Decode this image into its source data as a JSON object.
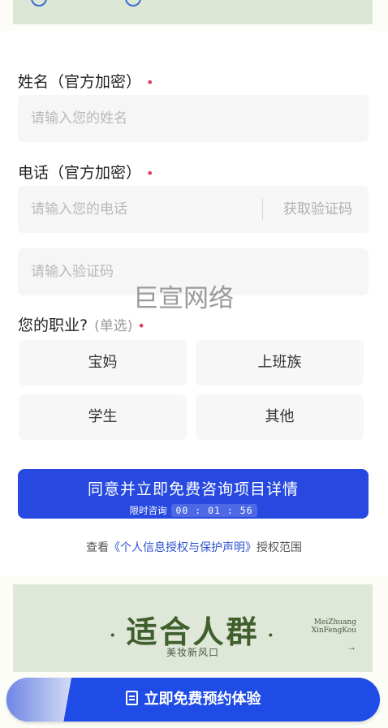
{
  "form": {
    "name_label": "姓名（官方加密）",
    "name_placeholder": "请输入您的姓名",
    "phone_label": "电话（官方加密）",
    "phone_placeholder": "请输入您的电话",
    "get_code": "获取验证码",
    "code_placeholder": "请输入验证码",
    "required_mark": "•",
    "job_label": "您的职业?",
    "job_hint": "(单选)",
    "options": [
      "宝妈",
      "上班族",
      "学生",
      "其他"
    ],
    "submit_main": "同意并立即免费咨询项目详情",
    "submit_sub": "限时咨询",
    "timer": "00 : 01 : 56",
    "agree_prefix": "查看",
    "agree_link": "《个人信息授权与保护声明》",
    "agree_suffix": "授权范围"
  },
  "watermark": "巨宣网络",
  "crowd": {
    "title": "适合人群",
    "subtitle": "美妆新风口",
    "tag_line1": "MeiZhuang",
    "tag_line2": "XinFengKou",
    "arrow": "→"
  },
  "cta": {
    "label": "立即免费预约体验"
  },
  "colors": {
    "accent": "#2749e0",
    "required": "#e23b5c",
    "banner": "#dfe7d8"
  }
}
